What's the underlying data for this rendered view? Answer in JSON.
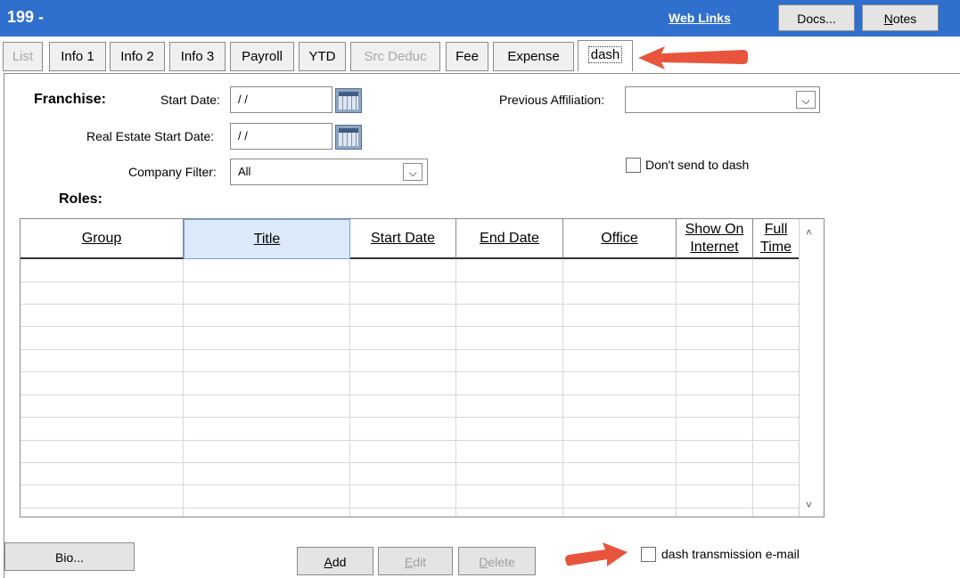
{
  "header": {
    "title": "199 -",
    "web_links": "Web Links",
    "docs_label": "Docs...",
    "notes_label": "Notes"
  },
  "tabs": [
    {
      "label": "List",
      "state": "disabled"
    },
    {
      "label": "Info 1",
      "state": "normal"
    },
    {
      "label": "Info 2",
      "state": "normal"
    },
    {
      "label": "Info 3",
      "state": "normal"
    },
    {
      "label": "Payroll",
      "state": "normal"
    },
    {
      "label": "YTD",
      "state": "normal"
    },
    {
      "label": "Src Deduc",
      "state": "disabled"
    },
    {
      "label": "Fee",
      "state": "normal"
    },
    {
      "label": "Expense",
      "state": "normal"
    },
    {
      "label": "dash",
      "state": "active"
    }
  ],
  "form": {
    "franchise_label": "Franchise:",
    "start_date_label": "Start Date:",
    "start_date_value": "/ /",
    "re_start_date_label": "Real Estate Start Date:",
    "re_start_date_value": "/ /",
    "company_filter_label": "Company Filter:",
    "company_filter_value": "All",
    "prev_affiliation_label": "Previous Affiliation:",
    "prev_affiliation_value": "",
    "dont_send_label": "Don't send to dash",
    "roles_label": "Roles:"
  },
  "grid": {
    "columns": [
      "Group",
      "Title",
      "Start Date",
      "End Date",
      "Office",
      "Show On Internet",
      "Full Time"
    ],
    "column_lines": [
      [
        "Group"
      ],
      [
        "Title"
      ],
      [
        "Start Date"
      ],
      [
        "End Date"
      ],
      [
        "Office"
      ],
      [
        "Show On",
        "Internet"
      ],
      [
        "Full",
        "Time"
      ]
    ],
    "selected_column": "Title",
    "rows": []
  },
  "buttons": {
    "bio": "Bio...",
    "add": "Add",
    "edit": "Edit",
    "delete": "Delete"
  },
  "dash_transmission_label": "dash transmission e-mail",
  "colors": {
    "titlebar": "#2f6fce",
    "arrow": "#e8553c"
  }
}
